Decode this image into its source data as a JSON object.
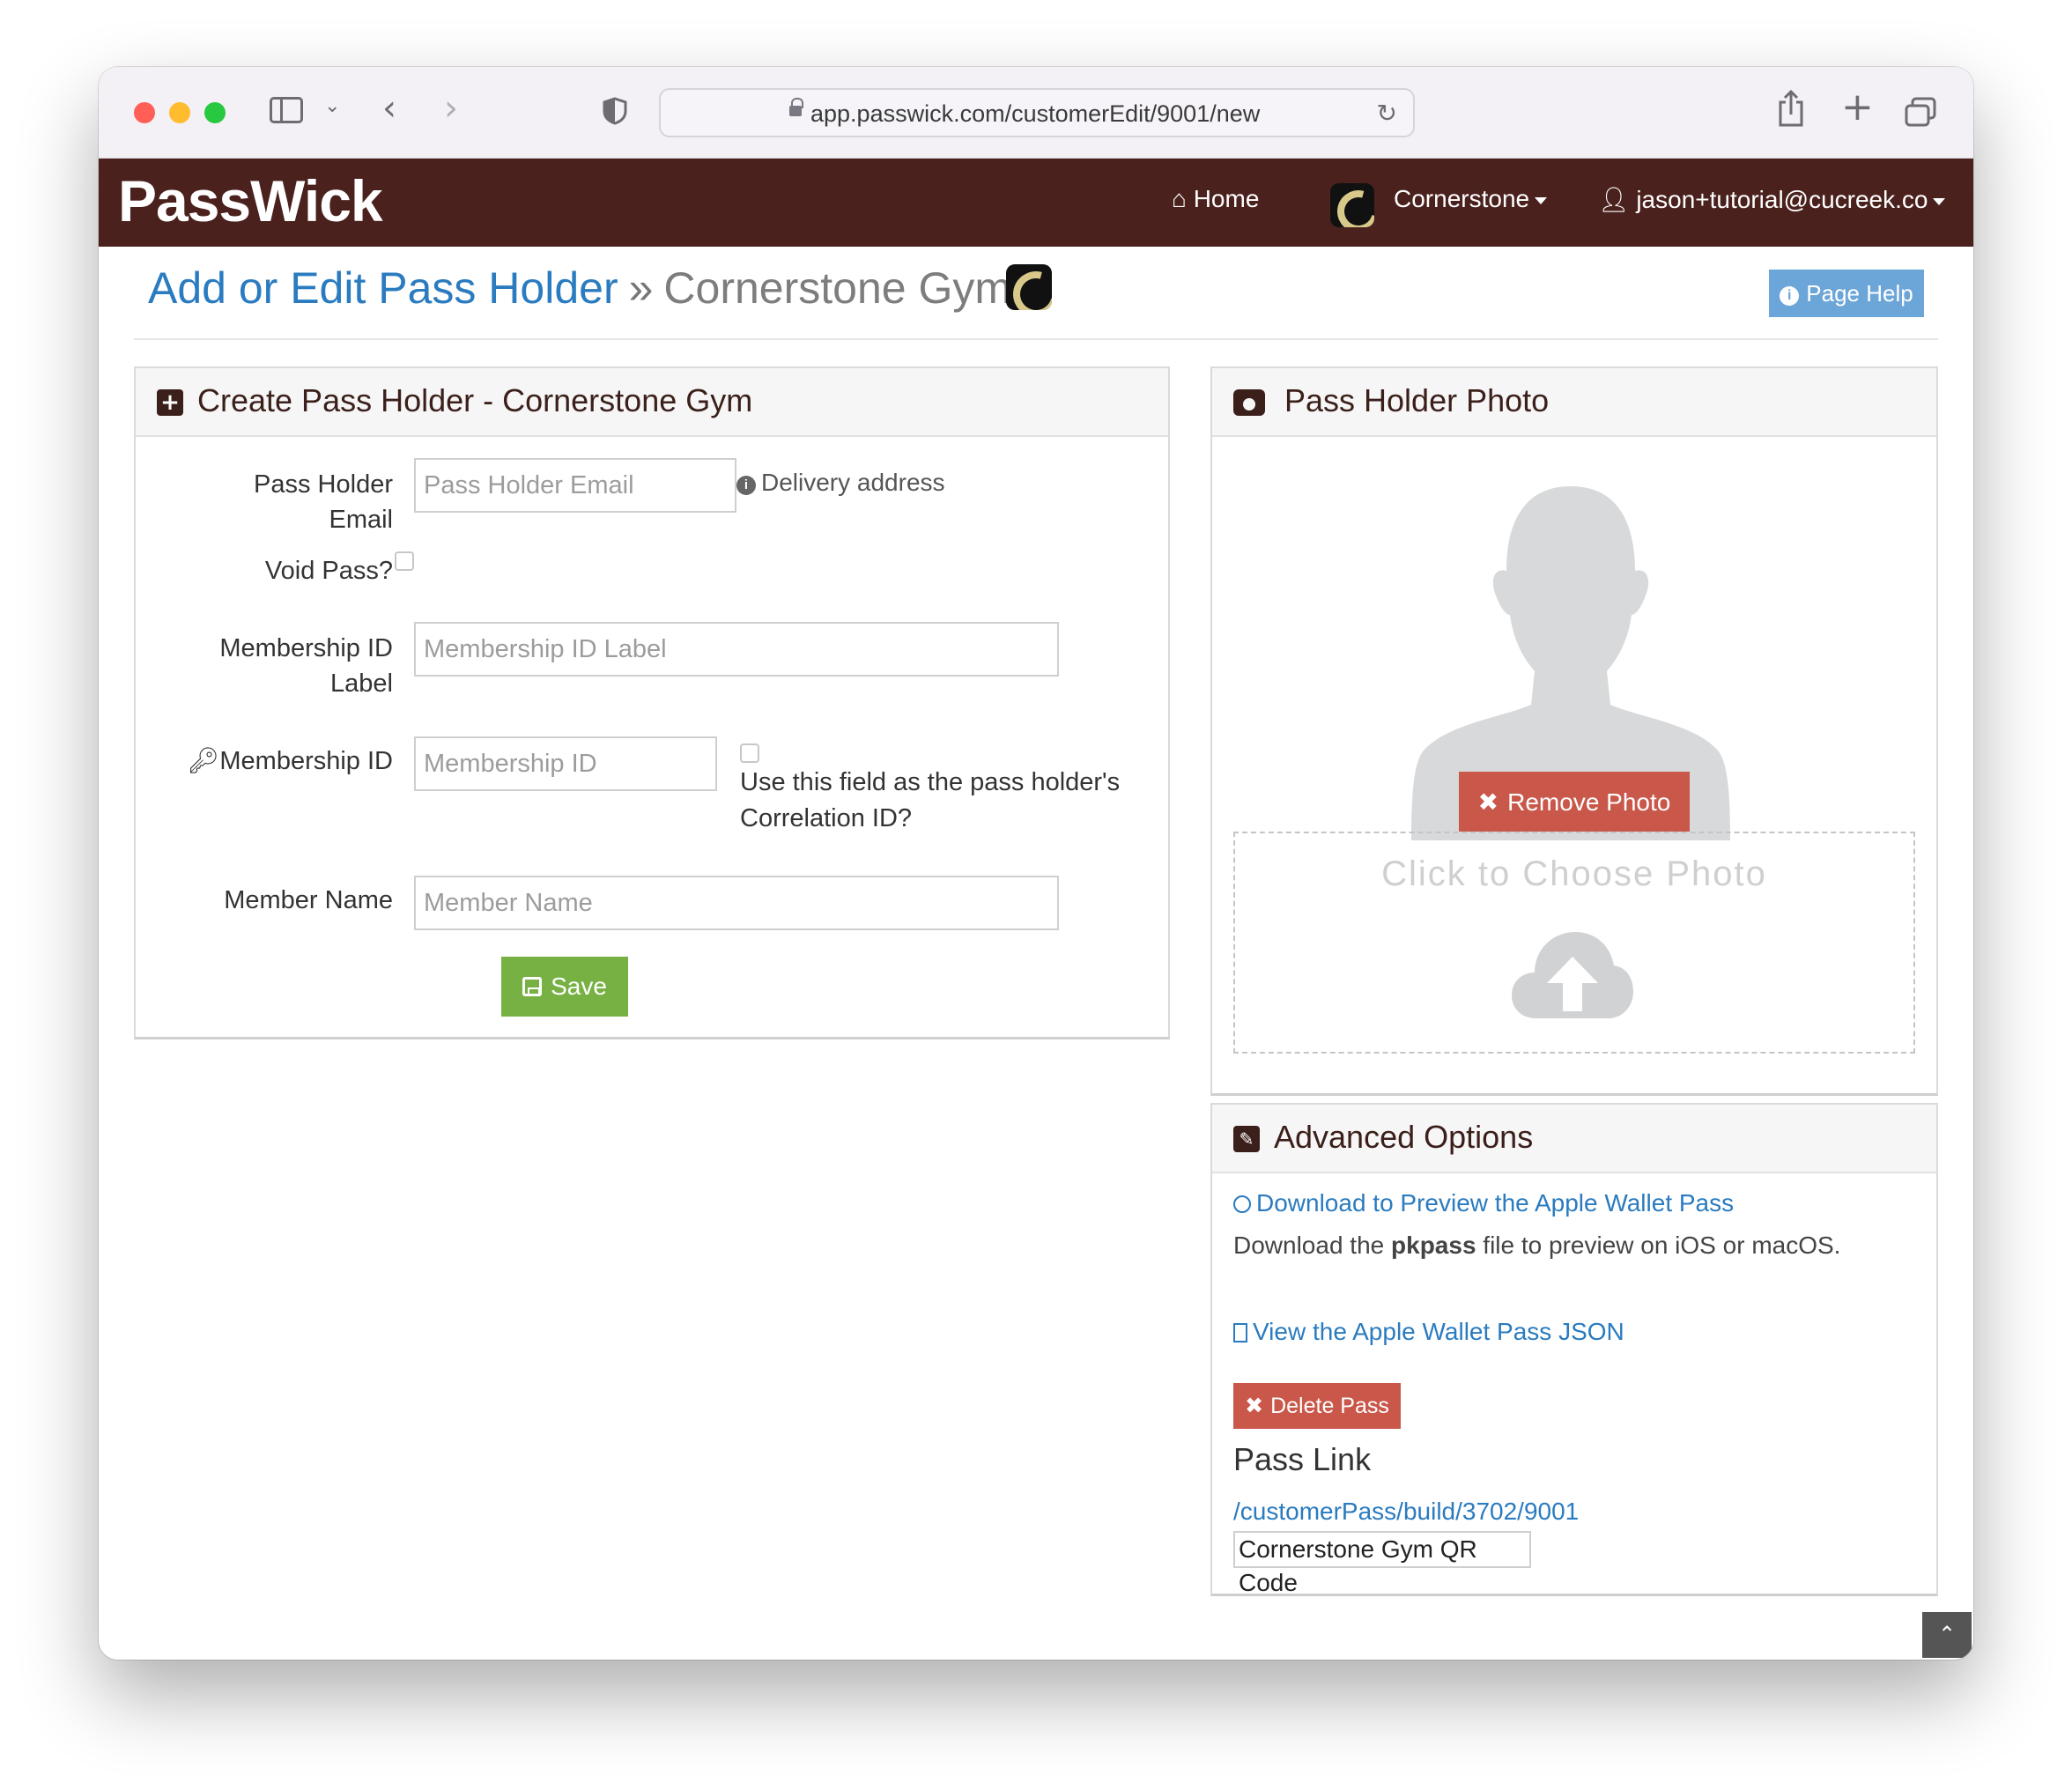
{
  "browser": {
    "url": "app.passwick.com/customerEdit/9001/new",
    "traffic_lights": {
      "close": "#ff5f57",
      "minimize": "#febc2e",
      "zoom": "#28c840"
    }
  },
  "navbar": {
    "brand": "PassWick",
    "home_label": "Home",
    "org_label": "Cornerstone",
    "user_label": "jason+tutorial@cucreek.co",
    "bg_color": "#4a211d"
  },
  "page": {
    "title": "Add or Edit Pass Holder",
    "separator": "»",
    "subtitle": "Cornerstone Gym",
    "help_label": "Page Help"
  },
  "create_panel": {
    "heading": "Create Pass Holder - Cornerstone Gym",
    "email_label": "Pass Holder Email",
    "email_placeholder": "Pass Holder Email",
    "email_hint": "Delivery address",
    "void_label": "Void Pass?",
    "membership_label_label_line1": "Membership ID",
    "membership_label_label_line2": "Label",
    "membership_label_placeholder": "Membership ID Label",
    "membership_id_label": "Membership ID",
    "membership_id_placeholder": "Membership ID",
    "correlation_line1": "Use this field as the pass holder's",
    "correlation_line2": "Correlation ID?",
    "member_name_label": "Member Name",
    "member_name_placeholder": "Member Name",
    "save_label": "Save",
    "save_color": "#77b144"
  },
  "photo_panel": {
    "heading": "Pass Holder Photo",
    "remove_label": "Remove Photo",
    "choose_label": "Click to Choose Photo",
    "remove_color": "#c9574a"
  },
  "advanced_panel": {
    "heading": "Advanced Options",
    "download_link": "Download to Preview the Apple Wallet Pass",
    "download_desc_pre": "Download the ",
    "download_desc_bold": "pkpass",
    "download_desc_post": " file to preview on iOS or macOS.",
    "json_link": "View the Apple Wallet Pass JSON",
    "delete_label": "Delete Pass",
    "pass_link_heading": "Pass Link",
    "pass_link_url": "/customerPass/build/3702/9001",
    "qr_label": "Cornerstone Gym QR Code"
  },
  "link_color": "#2a7bbf"
}
